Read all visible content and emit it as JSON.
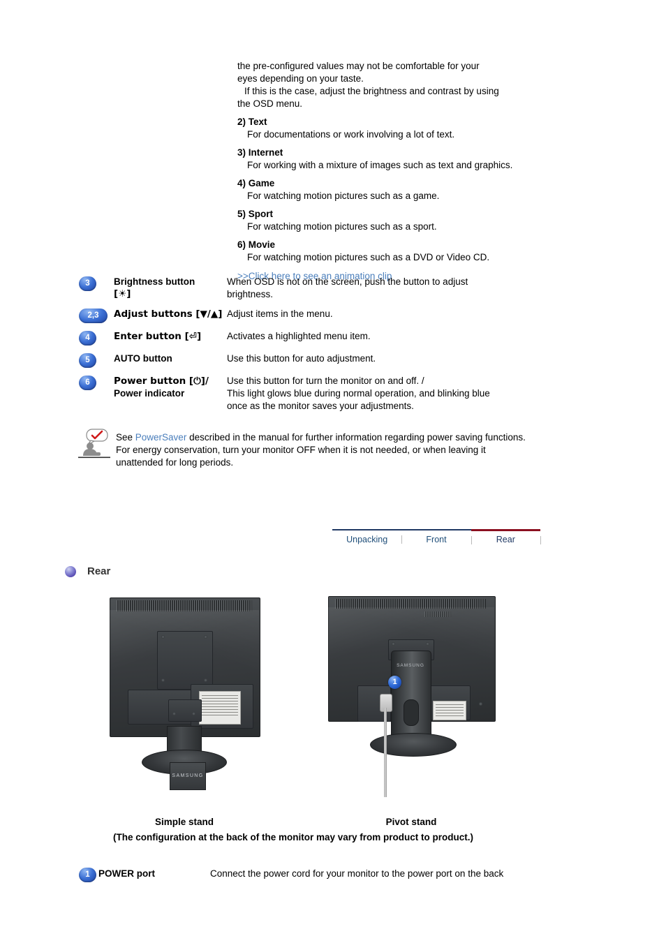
{
  "intro": {
    "lead_line1": "the pre-configured values may not be comfortable for your",
    "lead_line2": "eyes depending on your taste.",
    "lead_line3": "If this is the case, adjust the brightness and contrast by using",
    "lead_line4": "the OSD menu.",
    "modes": [
      {
        "title": "2) Text",
        "desc": "For documentations or work involving a lot of text."
      },
      {
        "title": "3) Internet",
        "desc": "For working with a mixture of images such as text and graphics."
      },
      {
        "title": "4) Game",
        "desc": "For watching motion pictures such as a game."
      },
      {
        "title": "5) Sport",
        "desc": "For watching motion pictures such as a sport."
      },
      {
        "title": "6) Movie",
        "desc": "For watching motion pictures such as a DVD or Video CD."
      }
    ],
    "animation_link": ">>Click here to see an animation clip"
  },
  "buttons": [
    {
      "badge": "3",
      "label_line1": "Brightness button",
      "label_line2": "[☀]",
      "desc_line1": "When OSD is not on the screen, push the button to adjust",
      "desc_line2": "brightness."
    },
    {
      "badge": "2,3",
      "label_line1": "Adjust buttons [▼/▲]",
      "label_line2": "",
      "desc_line1": "Adjust items in the menu.",
      "desc_line2": ""
    },
    {
      "badge": "4",
      "label_line1": "Enter button [⏎]",
      "label_line2": "",
      "desc_line1": "Activates a highlighted menu item.",
      "desc_line2": ""
    },
    {
      "badge": "5",
      "label_line1": "AUTO button",
      "label_line2": "",
      "desc_line1": "Use this button for auto adjustment.",
      "desc_line2": ""
    },
    {
      "badge": "6",
      "label_line1": "Power button [⏻]/",
      "label_line2": "Power indicator",
      "desc_line1": "Use this button for turn the monitor on and off. /",
      "desc_line2": "This light glows blue during normal operation, and blinking blue",
      "desc_line3": "once as the monitor saves your adjustments."
    }
  ],
  "note": {
    "text_before": "See ",
    "link": "PowerSaver",
    "text_after": " described in the manual for further information regarding power saving functions. For energy conservation, turn your monitor OFF when it is not needed, or when leaving it unattended for long periods."
  },
  "tabs": [
    {
      "label": "Unpacking",
      "active": false
    },
    {
      "label": "Front",
      "active": false
    },
    {
      "label": "Rear",
      "active": true
    }
  ],
  "section": {
    "heading": "Rear"
  },
  "figures": {
    "simple": {
      "caption": "Simple stand",
      "brand": "SAMSUNG"
    },
    "pivot": {
      "caption": "Pivot stand",
      "brand": "SAMSUNG",
      "badge": "1"
    },
    "note": "(The configuration at the back of the monitor may vary from product to product.)"
  },
  "port": {
    "badge": "1",
    "label": "POWER port",
    "desc": "Connect the power cord for your monitor to the power port on the back"
  },
  "colors": {
    "link": "#4a7ebb",
    "badge_blue": "#3b6fd4",
    "tab_active_underline": "#8b0f20",
    "tab_inactive_border": "#1f3864",
    "bullet_purple": "#5b4fb5"
  }
}
